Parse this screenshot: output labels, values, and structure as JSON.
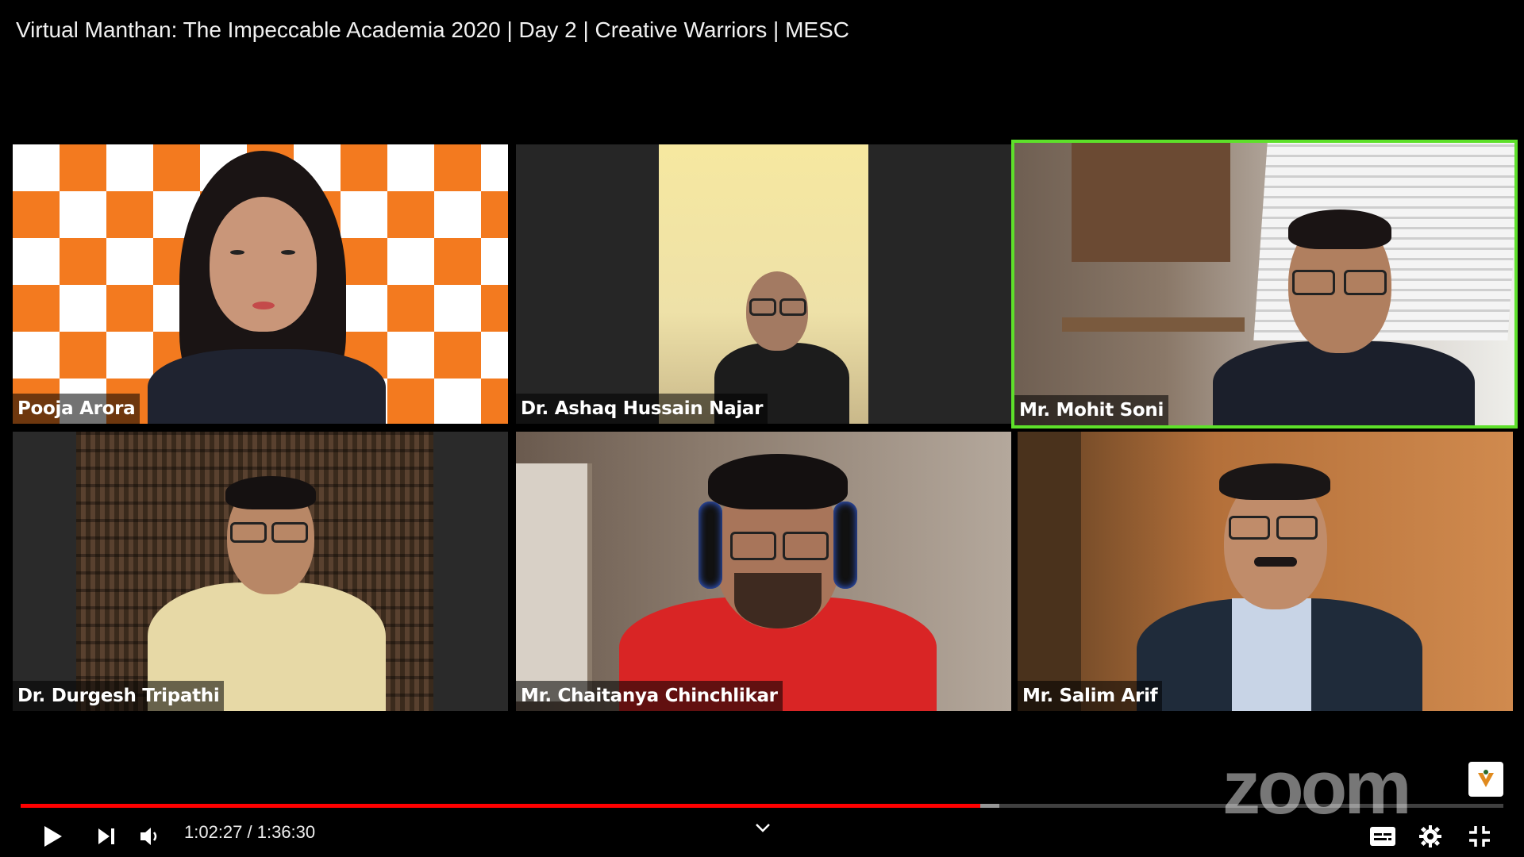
{
  "video": {
    "title": "Virtual Manthan: The Impeccable Academia 2020 | Day 2 | Creative Warriors | MESC"
  },
  "participants": [
    {
      "name": "Pooja Arora"
    },
    {
      "name": "Dr. Ashaq Hussain Najar"
    },
    {
      "name": "Mr. Mohit Soni",
      "active_speaker": true
    },
    {
      "name": "Dr. Durgesh Tripathi"
    },
    {
      "name": "Mr. Chaitanya Chinchlikar"
    },
    {
      "name": "Mr. Salim Arif"
    }
  ],
  "watermark": {
    "logo_text": "zoom"
  },
  "player": {
    "current_time": "1:02:27",
    "duration": "1:36:30",
    "time_display": "1:02:27 / 1:36:30",
    "progress_fraction": 0.647,
    "buffered_fraction": 0.66,
    "progress_color": "#ff0000"
  },
  "icons": {
    "play": "play-icon",
    "next": "next-icon",
    "volume": "volume-icon",
    "chevron": "chevron-down-icon",
    "captions": "captions-icon",
    "settings": "gear-icon",
    "exit_fullscreen": "exit-fullscreen-icon"
  },
  "colors": {
    "active_speaker_border": "#5ee02a",
    "background": "#000000"
  }
}
